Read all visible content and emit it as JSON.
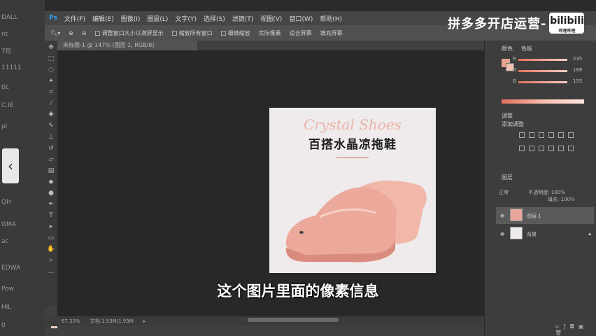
{
  "app": {
    "logo": "Ps",
    "menu": [
      "文件(F)",
      "编辑(E)",
      "图像(I)",
      "图层(L)",
      "文字(Y)",
      "选择(S)",
      "滤镜(T)",
      "视图(V)",
      "窗口(W)",
      "帮助(H)"
    ]
  },
  "options": [
    "调整窗口大小以满屏显示",
    "缩放所有窗口",
    "细微缩放",
    "实际像素",
    "适合屏幕",
    "填充屏幕"
  ],
  "document": {
    "tab": "未标题-1 @ 147% (图层 1, RGB/8)"
  },
  "artwork": {
    "script_title": "Crystal Shoes",
    "cn_title": "百搭水晶凉拖鞋",
    "colors": {
      "bg": "#efeaeb",
      "shoe": "#eba89b",
      "script": "#e8b3a8"
    }
  },
  "status": {
    "zoom": "67.33%",
    "doc": "文档:1.93M/1.93M"
  },
  "panels": {
    "color_tab": "颜色",
    "swatches_tab": "色板",
    "sliders": [
      {
        "label": "R",
        "value": "235"
      },
      {
        "label": "G",
        "value": "168"
      },
      {
        "label": "B",
        "value": "155"
      }
    ],
    "adjust_tab": "调整",
    "adjust_sub": "添加调整",
    "layers_tab": "图层",
    "blend_mode": "正常",
    "opacity_label": "不透明度:",
    "opacity": "100%",
    "fill_label": "填充:",
    "fill": "100%",
    "layers": [
      {
        "name": "图层 1"
      },
      {
        "name": "背景"
      }
    ]
  },
  "watermark": {
    "text": "拼多多开店运营-",
    "logo": "bilibili",
    "logo_sub": "哔哩哔哩"
  },
  "subtitle": "这个图片里面的像素信息",
  "desktop_left": [
    "DALL",
    "nt",
    "T形",
    "11111",
    "tic",
    "C.IE",
    "pl",
    "QH",
    "GMA",
    "ac",
    "EDWA",
    "Pow",
    "HiL",
    "0"
  ]
}
